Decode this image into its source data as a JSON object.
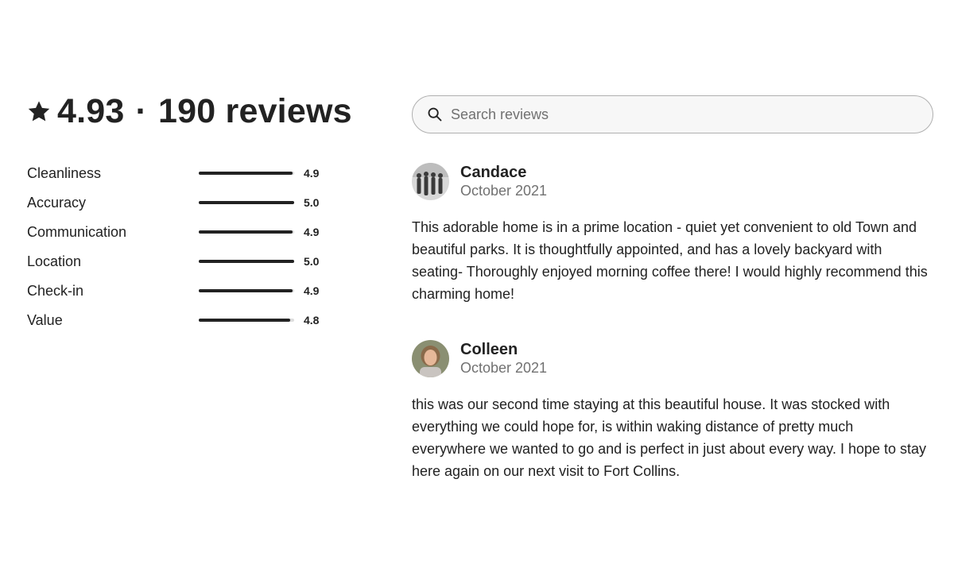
{
  "summary": {
    "rating": "4.93",
    "separator": "·",
    "review_count": "190 reviews"
  },
  "categories": [
    {
      "label": "Cleanliness",
      "value": "4.9",
      "fill_fraction": 0.98
    },
    {
      "label": "Accuracy",
      "value": "5.0",
      "fill_fraction": 1.0
    },
    {
      "label": "Communication",
      "value": "4.9",
      "fill_fraction": 0.98
    },
    {
      "label": "Location",
      "value": "5.0",
      "fill_fraction": 1.0
    },
    {
      "label": "Check-in",
      "value": "4.9",
      "fill_fraction": 0.98
    },
    {
      "label": "Value",
      "value": "4.8",
      "fill_fraction": 0.96
    }
  ],
  "search": {
    "placeholder": "Search reviews",
    "icon": "search-icon"
  },
  "reviews": [
    {
      "name": "Candace",
      "date": "October 2021",
      "text": "This adorable home is in a prime location - quiet yet convenient to old Town and beautiful parks. It is thoughtfully appointed, and has a lovely backyard with seating- Thoroughly enjoyed morning coffee there! I would highly recommend this charming home!"
    },
    {
      "name": "Colleen",
      "date": "October 2021",
      "text": "this was our second time staying at this beautiful house. It was stocked with everything we could hope for, is within waking distance of pretty much everywhere we wanted to go and is perfect in just about every way. I hope to stay here again on our next visit to Fort Collins."
    }
  ],
  "colors": {
    "text": "#222222",
    "muted": "#717171",
    "bar_track": "#dddddd",
    "bar_fill": "#222222"
  }
}
